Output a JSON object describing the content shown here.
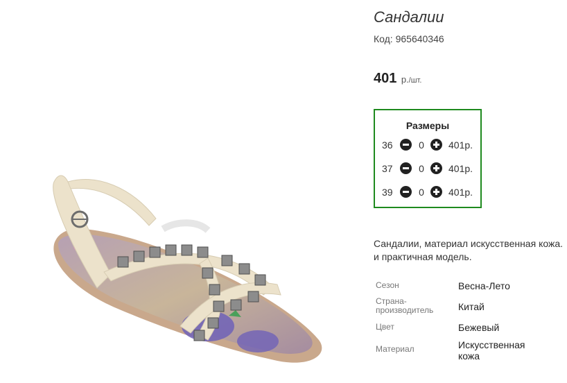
{
  "product": {
    "title": "Сандалии",
    "code": "Код: 965640346",
    "price": "401",
    "price_unit": "р.",
    "price_per": "/шт."
  },
  "sizes": {
    "title": "Размеры",
    "rows": [
      {
        "size": "36",
        "qty": "0",
        "sum": "401р."
      },
      {
        "size": "37",
        "qty": "0",
        "sum": "401р."
      },
      {
        "size": "39",
        "qty": "0",
        "sum": "401р."
      }
    ]
  },
  "description": {
    "line1": "Сандалии, материал искусственная кожа.",
    "line2": "и практичная модель."
  },
  "attributes": {
    "season": {
      "label": "Сезон",
      "value": "Весна-Лето"
    },
    "country": {
      "label_line1": "Страна-",
      "label_line2": "производитель",
      "value": "Китай"
    },
    "color": {
      "label": "Цвет",
      "value": "Бежевый"
    },
    "material": {
      "label": "Материал",
      "value_line1": "Искусственная",
      "value_line2": "кожа"
    }
  },
  "colors": {
    "border_green": "#1e8a1e",
    "stepper_dark": "#222222",
    "sandal_beige": "#eee5cf",
    "insole_mauve": "#a08a9c",
    "studs_silver": "#8c8c8c"
  },
  "icons": [
    "minus-icon",
    "plus-icon"
  ]
}
